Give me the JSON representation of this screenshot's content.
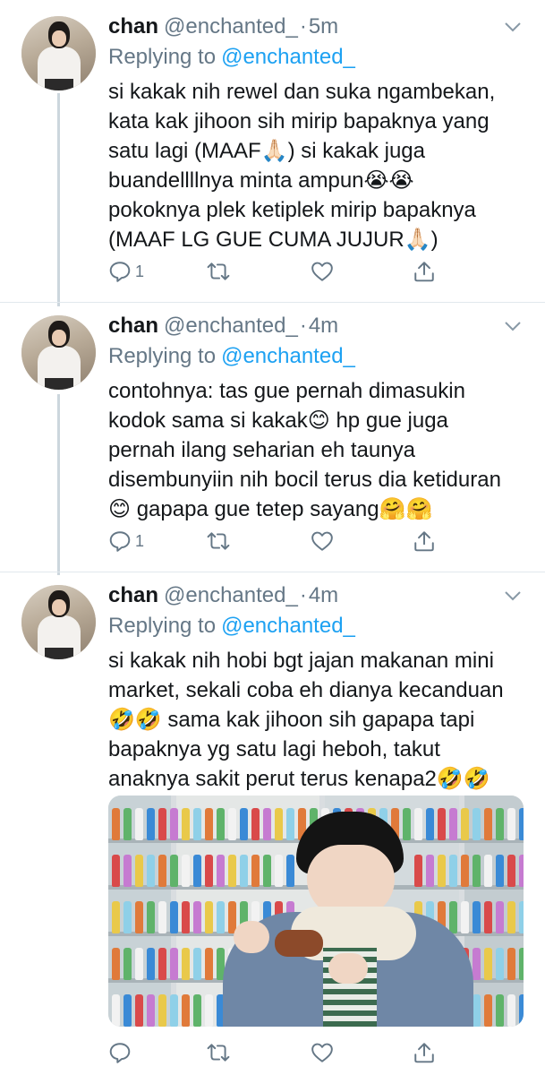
{
  "tweets": [
    {
      "name": "chan",
      "handle": "@enchanted_",
      "separator": "·",
      "time": "5m",
      "replying_label": "Replying to",
      "replying_handle": "@enchanted_",
      "text": "si kakak nih rewel dan suka ngambekan,\nkata kak jihoon sih mirip bapaknya yang\nsatu lagi (MAAF🙏🏻) si kakak juga\nbuandellllnya minta ampun😭😭\npokoknya plek ketiplek mirip bapaknya\n(MAAF LG GUE CUMA JUJUR🙏🏻)",
      "reply_count": "1"
    },
    {
      "name": "chan",
      "handle": "@enchanted_",
      "separator": "·",
      "time": "4m",
      "replying_label": "Replying to",
      "replying_handle": "@enchanted_",
      "text": "contohnya: tas gue pernah dimasukin\nkodok sama si kakak😊 hp gue juga\npernah ilang seharian eh taunya\ndisembunyiin nih bocil terus dia ketiduran\n😊 gapapa gue tetep sayang🤗🤗",
      "reply_count": "1"
    },
    {
      "name": "chan",
      "handle": "@enchanted_",
      "separator": "·",
      "time": "4m",
      "replying_label": "Replying to",
      "replying_handle": "@enchanted_",
      "text": "si kakak nih hobi bgt jajan makanan mini\nmarket, sekali coba eh dianya kecanduan\n🤣🤣 sama kak jihoon sih gapapa tapi\nbapaknya yg satu lagi heboh, takut\nanaknya sakit perut terus kenapa2🤣🤣",
      "reply_count": ""
    }
  ],
  "icons": {
    "reply": "reply-icon",
    "retweet": "retweet-icon",
    "like": "heart-icon",
    "share": "share-icon",
    "caret": "chevron-down-icon"
  },
  "colors": {
    "text": "#14171a",
    "muted": "#657786",
    "link": "#1da1f2",
    "thread_line": "#ccd6dd"
  }
}
